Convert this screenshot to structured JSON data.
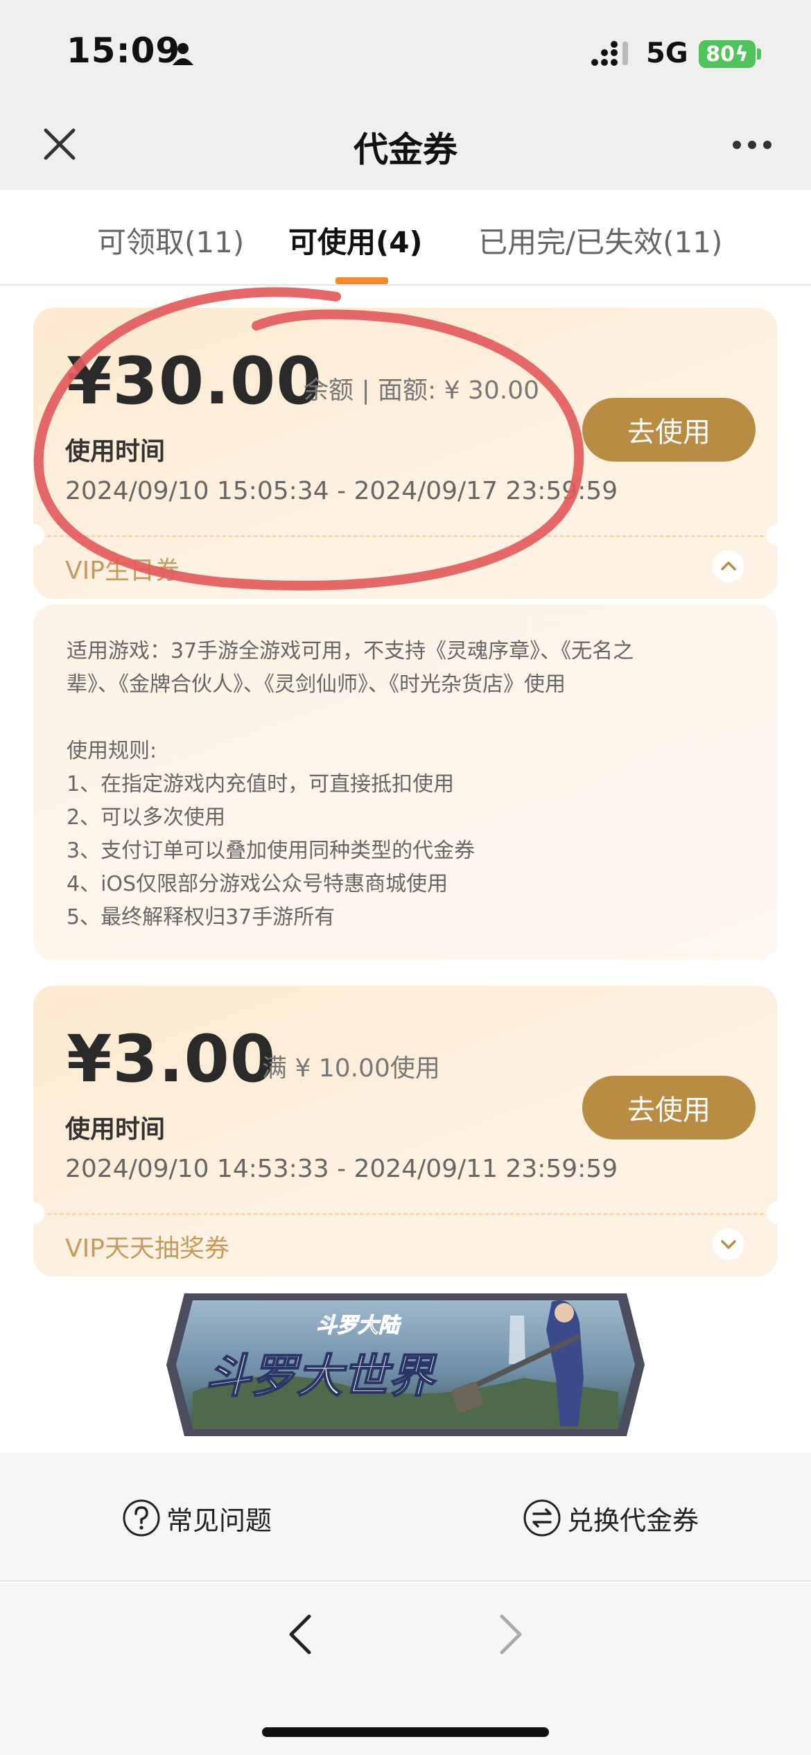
{
  "status_bar": {
    "time": "15:09",
    "network": "5G",
    "battery": "80"
  },
  "header": {
    "title": "代金券"
  },
  "tabs": [
    {
      "label": "可领取(11)"
    },
    {
      "label": "可使用(4)"
    },
    {
      "label": "已用完/已失效(11)"
    }
  ],
  "coupons": [
    {
      "amount": "¥30.00",
      "note": "余额 | 面额: ¥ 30.00",
      "time_label": "使用时间",
      "time_range": "2024/09/10 15:05:34 - 2024/09/17 23:59:59",
      "button": "去使用",
      "type": "VIP生日券"
    },
    {
      "amount": "¥3.00",
      "note": "满 ¥ 10.00使用",
      "time_label": "使用时间",
      "time_range": "2024/09/10 14:53:33 - 2024/09/11 23:59:59",
      "button": "去使用",
      "type": "VIP天天抽奖券"
    }
  ],
  "details": {
    "applicable": "适用游戏：37手游全游戏可用，不支持《灵魂序章》、《无名之",
    "applicable_2": "辈》、《金牌合伙人》、《灵剑仙师》、《时光杂货店》使用",
    "rules_title": "使用规则:",
    "rules": [
      "1、在指定游戏内充值时，可直接抵扣使用",
      "2、可以多次使用",
      "3、支付订单可以叠加使用同种类型的代金券",
      "4、iOS仅限部分游戏公众号特惠商城使用",
      "5、最终解释权归37手游所有"
    ]
  },
  "banner": {
    "logo_text": "斗罗大陆",
    "title": "斗罗大世界"
  },
  "bottom": {
    "faq": "常见问题",
    "exchange": "兑换代金券"
  },
  "colors": {
    "accent": "#f08b2c",
    "button": "#b98c43",
    "annotation": "#e35b5b"
  }
}
